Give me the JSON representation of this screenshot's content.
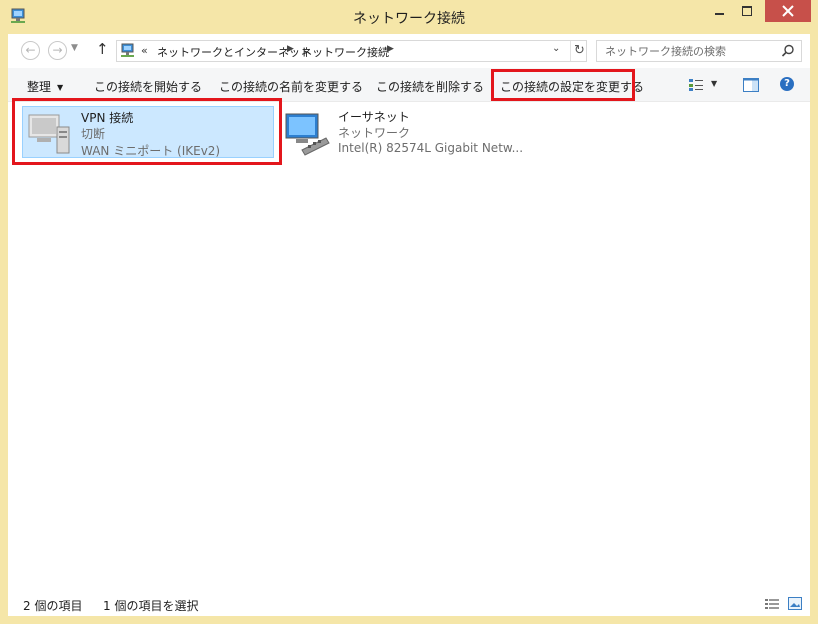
{
  "window": {
    "title": "ネットワーク接続"
  },
  "address": {
    "overflow": "«",
    "crumbs": [
      "ネットワークとインターネット",
      "ネットワーク接続"
    ]
  },
  "search": {
    "placeholder": "ネットワーク接続の検索"
  },
  "commands": {
    "organize": "整理",
    "start": "この接続を開始する",
    "rename": "この接続の名前を変更する",
    "delete": "この接続を削除する",
    "change_settings": "この接続の設定を変更する"
  },
  "items": [
    {
      "name": "VPN 接続",
      "status": "切断",
      "device": "WAN ミニポート (IKEv2)",
      "selected": true
    },
    {
      "name": "イーサネット",
      "status": "ネットワーク",
      "device": "Intel(R) 82574L Gigabit Netw...",
      "selected": false
    }
  ],
  "status_bar": {
    "count": "2 個の項目",
    "selection": "1 個の項目を選択"
  },
  "colors": {
    "frame": "#f5e6a8",
    "close_button": "#c7504a",
    "selection": "#cce8ff",
    "annotation": "#e3161c"
  }
}
